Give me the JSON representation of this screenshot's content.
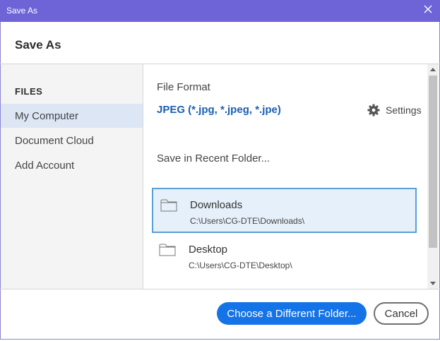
{
  "window": {
    "title": "Save As"
  },
  "header": {
    "title": "Save As"
  },
  "sidebar": {
    "section": "FILES",
    "items": [
      {
        "label": "My Computer",
        "selected": true
      },
      {
        "label": "Document Cloud",
        "selected": false
      },
      {
        "label": "Add Account",
        "selected": false
      }
    ]
  },
  "main": {
    "format_label": "File Format",
    "format_value": "JPEG (*.jpg, *.jpeg, *.jpe)",
    "settings_label": "Settings",
    "recent_label": "Save in Recent Folder...",
    "folders": [
      {
        "name": "Downloads",
        "path": "C:\\Users\\CG-DTE\\Downloads\\",
        "selected": true
      },
      {
        "name": "Desktop",
        "path": "C:\\Users\\CG-DTE\\Desktop\\",
        "selected": false
      }
    ]
  },
  "footer": {
    "choose_label": "Choose a Different Folder...",
    "cancel_label": "Cancel"
  },
  "colors": {
    "titlebar": "#6e64d8",
    "accent": "#1473e6",
    "format_text": "#1b5fb2",
    "selection": "#dce6f5"
  },
  "icons": [
    "close-icon",
    "gear-icon",
    "folder-icon"
  ]
}
